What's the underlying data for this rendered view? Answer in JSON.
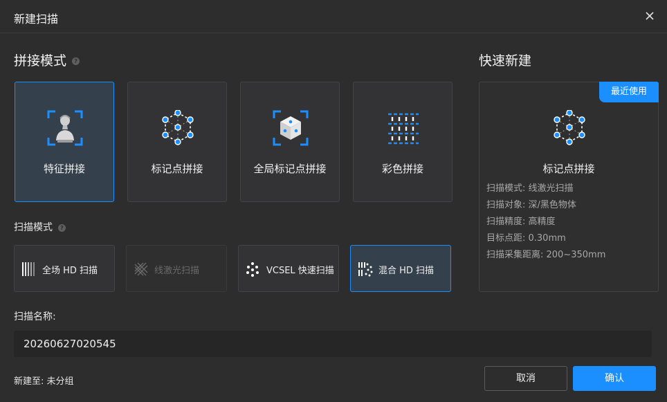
{
  "dialog": {
    "title": "新建扫描",
    "close_icon": "close-icon"
  },
  "splice_mode": {
    "title": "拼接模式",
    "help_icon": "?",
    "cards": [
      {
        "label": "特征拼接",
        "icon": "bust-feature-icon",
        "selected": true
      },
      {
        "label": "标记点拼接",
        "icon": "marker-points-icon",
        "selected": false
      },
      {
        "label": "全局标记点拼接",
        "icon": "global-marker-cube-icon",
        "selected": false
      },
      {
        "label": "彩色拼接",
        "icon": "color-pattern-icon",
        "selected": false
      }
    ]
  },
  "scan_mode": {
    "title": "扫描模式",
    "help_icon": "?",
    "modes": [
      {
        "label": "全场 HD 扫描",
        "icon": "fullfield-hd-icon",
        "selected": false,
        "disabled": false
      },
      {
        "label": "线激光扫描",
        "icon": "line-laser-icon",
        "selected": false,
        "disabled": true
      },
      {
        "label": "VCSEL 快速扫描",
        "icon": "vcsel-icon",
        "selected": false,
        "disabled": false
      },
      {
        "label": "混合 HD 扫描",
        "icon": "hybrid-hd-icon",
        "selected": true,
        "disabled": false
      }
    ]
  },
  "scan_name": {
    "label": "扫描名称:",
    "value": "20260627020545"
  },
  "new_to": "新建至: 未分组",
  "quick": {
    "title": "快速新建",
    "badge": "最近使用",
    "card_title": "标记点拼接",
    "specs": [
      "扫描模式: 线激光扫描",
      "扫描对象: 深/黑色物体",
      "扫描精度: 高精度",
      "目标点距: 0.30mm",
      "扫描采集距离: 200~350mm"
    ]
  },
  "buttons": {
    "cancel": "取消",
    "ok": "确认"
  },
  "colors": {
    "accent": "#1b8fff",
    "background": "#2d2d2e",
    "card": "#333335",
    "selected_card": "#35404d"
  }
}
